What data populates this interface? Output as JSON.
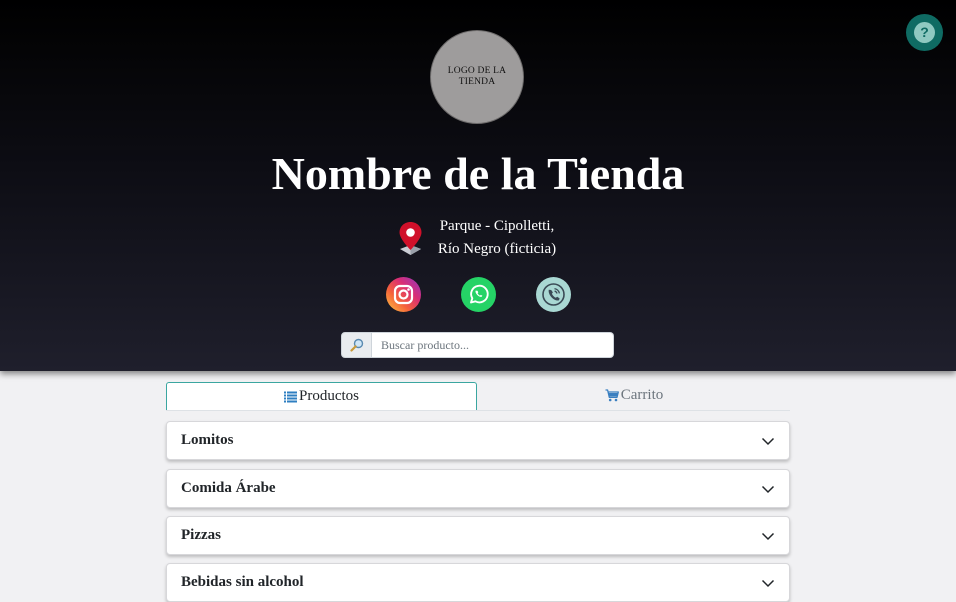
{
  "header": {
    "logo_text": "LOGO DE LA TIENDA",
    "store_name": "Nombre de la Tienda",
    "address_line1": "Parque - Cipolletti,",
    "address_line2": "Río Negro (ficticia)",
    "icons": {
      "help": "help-question-icon",
      "location": "map-pin-icon",
      "instagram": "instagram-icon",
      "whatsapp": "whatsapp-icon",
      "phone": "phone-icon",
      "search": "magnifier-icon"
    },
    "colors": {
      "gradient_top": "#000000",
      "gradient_bottom": "#1f1f2c",
      "help_button": "#0f6b63",
      "whatsapp": "#25d366",
      "phone_bg": "#a9d8d3",
      "pin": "#d0102a"
    }
  },
  "search": {
    "placeholder": "Buscar producto...",
    "value": ""
  },
  "tabs": [
    {
      "label": "Productos",
      "icon": "list-icon",
      "active": true
    },
    {
      "label": "Carrito",
      "icon": "cart-icon",
      "active": false
    }
  ],
  "categories": [
    {
      "label": "Lomitos"
    },
    {
      "label": "Comida Árabe"
    },
    {
      "label": "Pizzas"
    },
    {
      "label": "Bebidas sin alcohol"
    }
  ],
  "accent_color": "#3aa6a0"
}
